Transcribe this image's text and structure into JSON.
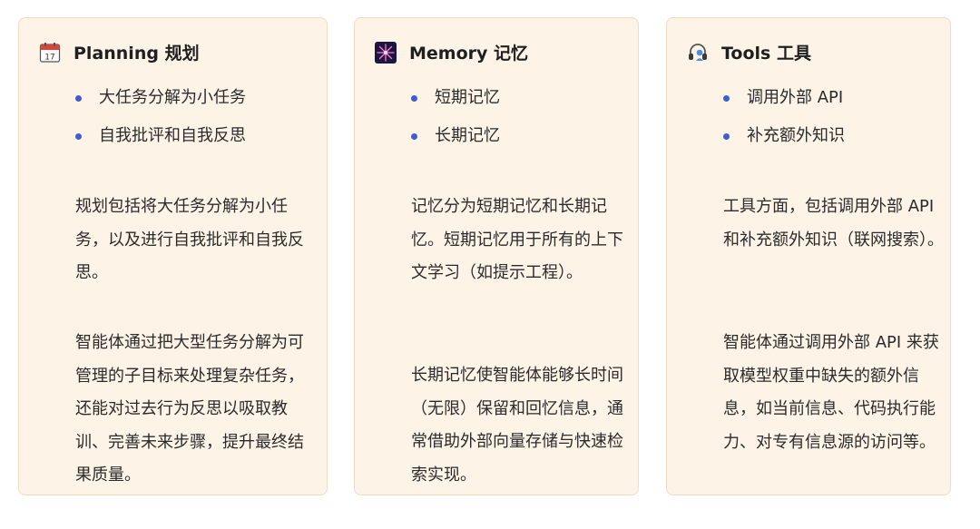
{
  "cards": [
    {
      "icon": "calendar-icon",
      "title": "Planning 规划",
      "bullets": [
        "大任务分解为小任务",
        "自我批评和自我反思"
      ],
      "paragraphs": [
        "规划包括将大任务分解为小任务，以及进行自我批评和自我反思。",
        "智能体通过把大型任务分解为可管理的子目标来处理复杂任务，还能对过去行为反思以吸取教训、完善未来步骤，提升最终结果质量。"
      ]
    },
    {
      "icon": "fireworks-icon",
      "title": "Memory 记忆",
      "bullets": [
        "短期记忆",
        "长期记忆"
      ],
      "paragraphs": [
        "记忆分为短期记忆和长期记忆。短期记忆用于所有的上下文学习（如提示工程）。",
        "长期记忆使智能体能够长时间（无限）保留和回忆信息，通常借助外部向量存储与快速检索实现。"
      ]
    },
    {
      "icon": "headset-icon",
      "title": "Tools 工具",
      "bullets": [
        "调用外部 API",
        "补充额外知识"
      ],
      "paragraphs": [
        "工具方面，包括调用外部 API 和补充额外知识（联网搜索）。",
        "智能体通过调用外部 API 来获取模型权重中缺失的额外信息，如当前信息、代码执行能力、对专有信息源的访问等。"
      ]
    }
  ],
  "colors": {
    "card_bg": "#fdf3e7",
    "card_border": "#eedcc3",
    "bullet": "#3b5ed6"
  }
}
